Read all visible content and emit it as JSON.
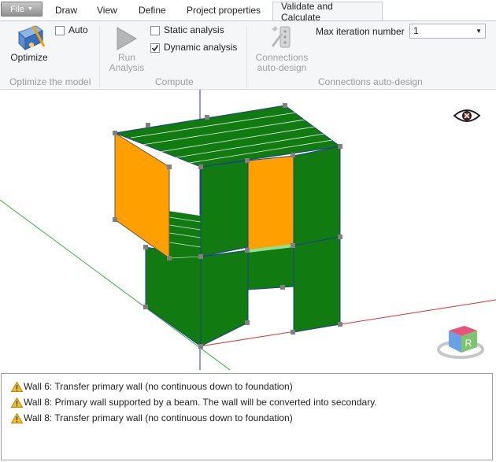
{
  "tabs": {
    "file": "File",
    "draw": "Draw",
    "view": "View",
    "define": "Define",
    "project_properties": "Project properties",
    "validate": "Validate and Calculate"
  },
  "ribbon": {
    "optimize_label": "Optimize",
    "auto_label": "Auto",
    "auto_checked": false,
    "group_optimize": "Optimize the model",
    "run_label_1": "Run",
    "run_label_2": "Analysis",
    "static_label": "Static analysis",
    "static_checked": false,
    "dynamic_label": "Dynamic analysis",
    "dynamic_checked": true,
    "group_compute": "Compute",
    "conn_label_1": "Connections",
    "conn_label_2": "auto-design",
    "max_iter_label": "Max iteration number",
    "max_iter_value": "1",
    "group_connections": "Connections auto-design"
  },
  "viewcube": {
    "face_label": "R"
  },
  "log": {
    "messages": [
      "Wall 6: Transfer primary wall (no continuous down to foundation)",
      "Wall 8: Primary wall supported by a beam. The wall will be converted into secondary.",
      "Wall 8: Transfer primary wall (no continuous down to foundation)"
    ]
  },
  "colors": {
    "wall_green": "#117a11",
    "wall_orange": "#ff9f00",
    "axis_red": "#d93030",
    "axis_green": "#3ba83b",
    "axis_blue": "#2b2bd8",
    "accent_warning": "#f0c020"
  }
}
